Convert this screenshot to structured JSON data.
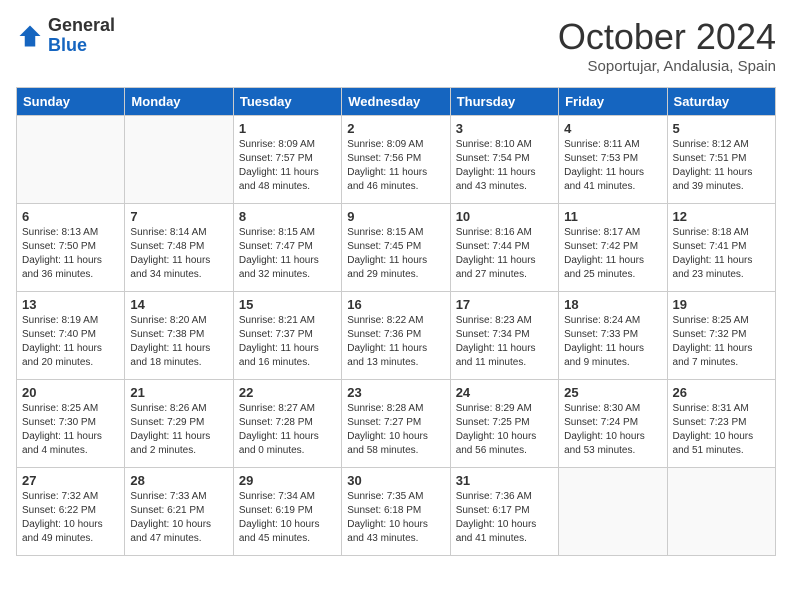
{
  "header": {
    "logo_general": "General",
    "logo_blue": "Blue",
    "month_title": "October 2024",
    "subtitle": "Soportujar, Andalusia, Spain"
  },
  "days_of_week": [
    "Sunday",
    "Monday",
    "Tuesday",
    "Wednesday",
    "Thursday",
    "Friday",
    "Saturday"
  ],
  "weeks": [
    [
      {
        "day": "",
        "empty": true
      },
      {
        "day": "",
        "empty": true
      },
      {
        "day": "1",
        "sunrise": "Sunrise: 8:09 AM",
        "sunset": "Sunset: 7:57 PM",
        "daylight": "Daylight: 11 hours and 48 minutes."
      },
      {
        "day": "2",
        "sunrise": "Sunrise: 8:09 AM",
        "sunset": "Sunset: 7:56 PM",
        "daylight": "Daylight: 11 hours and 46 minutes."
      },
      {
        "day": "3",
        "sunrise": "Sunrise: 8:10 AM",
        "sunset": "Sunset: 7:54 PM",
        "daylight": "Daylight: 11 hours and 43 minutes."
      },
      {
        "day": "4",
        "sunrise": "Sunrise: 8:11 AM",
        "sunset": "Sunset: 7:53 PM",
        "daylight": "Daylight: 11 hours and 41 minutes."
      },
      {
        "day": "5",
        "sunrise": "Sunrise: 8:12 AM",
        "sunset": "Sunset: 7:51 PM",
        "daylight": "Daylight: 11 hours and 39 minutes."
      }
    ],
    [
      {
        "day": "6",
        "sunrise": "Sunrise: 8:13 AM",
        "sunset": "Sunset: 7:50 PM",
        "daylight": "Daylight: 11 hours and 36 minutes."
      },
      {
        "day": "7",
        "sunrise": "Sunrise: 8:14 AM",
        "sunset": "Sunset: 7:48 PM",
        "daylight": "Daylight: 11 hours and 34 minutes."
      },
      {
        "day": "8",
        "sunrise": "Sunrise: 8:15 AM",
        "sunset": "Sunset: 7:47 PM",
        "daylight": "Daylight: 11 hours and 32 minutes."
      },
      {
        "day": "9",
        "sunrise": "Sunrise: 8:15 AM",
        "sunset": "Sunset: 7:45 PM",
        "daylight": "Daylight: 11 hours and 29 minutes."
      },
      {
        "day": "10",
        "sunrise": "Sunrise: 8:16 AM",
        "sunset": "Sunset: 7:44 PM",
        "daylight": "Daylight: 11 hours and 27 minutes."
      },
      {
        "day": "11",
        "sunrise": "Sunrise: 8:17 AM",
        "sunset": "Sunset: 7:42 PM",
        "daylight": "Daylight: 11 hours and 25 minutes."
      },
      {
        "day": "12",
        "sunrise": "Sunrise: 8:18 AM",
        "sunset": "Sunset: 7:41 PM",
        "daylight": "Daylight: 11 hours and 23 minutes."
      }
    ],
    [
      {
        "day": "13",
        "sunrise": "Sunrise: 8:19 AM",
        "sunset": "Sunset: 7:40 PM",
        "daylight": "Daylight: 11 hours and 20 minutes."
      },
      {
        "day": "14",
        "sunrise": "Sunrise: 8:20 AM",
        "sunset": "Sunset: 7:38 PM",
        "daylight": "Daylight: 11 hours and 18 minutes."
      },
      {
        "day": "15",
        "sunrise": "Sunrise: 8:21 AM",
        "sunset": "Sunset: 7:37 PM",
        "daylight": "Daylight: 11 hours and 16 minutes."
      },
      {
        "day": "16",
        "sunrise": "Sunrise: 8:22 AM",
        "sunset": "Sunset: 7:36 PM",
        "daylight": "Daylight: 11 hours and 13 minutes."
      },
      {
        "day": "17",
        "sunrise": "Sunrise: 8:23 AM",
        "sunset": "Sunset: 7:34 PM",
        "daylight": "Daylight: 11 hours and 11 minutes."
      },
      {
        "day": "18",
        "sunrise": "Sunrise: 8:24 AM",
        "sunset": "Sunset: 7:33 PM",
        "daylight": "Daylight: 11 hours and 9 minutes."
      },
      {
        "day": "19",
        "sunrise": "Sunrise: 8:25 AM",
        "sunset": "Sunset: 7:32 PM",
        "daylight": "Daylight: 11 hours and 7 minutes."
      }
    ],
    [
      {
        "day": "20",
        "sunrise": "Sunrise: 8:25 AM",
        "sunset": "Sunset: 7:30 PM",
        "daylight": "Daylight: 11 hours and 4 minutes."
      },
      {
        "day": "21",
        "sunrise": "Sunrise: 8:26 AM",
        "sunset": "Sunset: 7:29 PM",
        "daylight": "Daylight: 11 hours and 2 minutes."
      },
      {
        "day": "22",
        "sunrise": "Sunrise: 8:27 AM",
        "sunset": "Sunset: 7:28 PM",
        "daylight": "Daylight: 11 hours and 0 minutes."
      },
      {
        "day": "23",
        "sunrise": "Sunrise: 8:28 AM",
        "sunset": "Sunset: 7:27 PM",
        "daylight": "Daylight: 10 hours and 58 minutes."
      },
      {
        "day": "24",
        "sunrise": "Sunrise: 8:29 AM",
        "sunset": "Sunset: 7:25 PM",
        "daylight": "Daylight: 10 hours and 56 minutes."
      },
      {
        "day": "25",
        "sunrise": "Sunrise: 8:30 AM",
        "sunset": "Sunset: 7:24 PM",
        "daylight": "Daylight: 10 hours and 53 minutes."
      },
      {
        "day": "26",
        "sunrise": "Sunrise: 8:31 AM",
        "sunset": "Sunset: 7:23 PM",
        "daylight": "Daylight: 10 hours and 51 minutes."
      }
    ],
    [
      {
        "day": "27",
        "sunrise": "Sunrise: 7:32 AM",
        "sunset": "Sunset: 6:22 PM",
        "daylight": "Daylight: 10 hours and 49 minutes."
      },
      {
        "day": "28",
        "sunrise": "Sunrise: 7:33 AM",
        "sunset": "Sunset: 6:21 PM",
        "daylight": "Daylight: 10 hours and 47 minutes."
      },
      {
        "day": "29",
        "sunrise": "Sunrise: 7:34 AM",
        "sunset": "Sunset: 6:19 PM",
        "daylight": "Daylight: 10 hours and 45 minutes."
      },
      {
        "day": "30",
        "sunrise": "Sunrise: 7:35 AM",
        "sunset": "Sunset: 6:18 PM",
        "daylight": "Daylight: 10 hours and 43 minutes."
      },
      {
        "day": "31",
        "sunrise": "Sunrise: 7:36 AM",
        "sunset": "Sunset: 6:17 PM",
        "daylight": "Daylight: 10 hours and 41 minutes."
      },
      {
        "day": "",
        "empty": true
      },
      {
        "day": "",
        "empty": true
      }
    ]
  ]
}
